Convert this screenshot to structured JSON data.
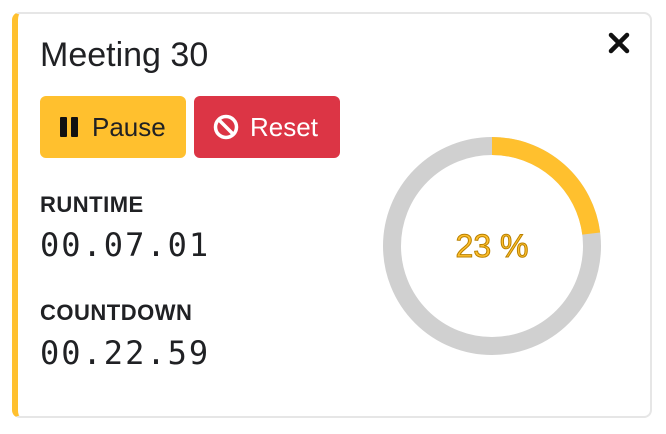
{
  "timer": {
    "title": "Meeting 30",
    "accent_color": "#ffc02e",
    "danger_color": "#dc3545",
    "track_color": "#d0d0d0",
    "close_icon": "close-icon",
    "buttons": {
      "pause": {
        "label": "Pause",
        "icon": "pause-icon"
      },
      "reset": {
        "label": "Reset",
        "icon": "ban-icon"
      }
    },
    "runtime": {
      "label": "RUNTIME",
      "value": "00.07.01"
    },
    "countdown": {
      "label": "COUNTDOWN",
      "value": "00.22.59"
    },
    "progress": {
      "percent": 23,
      "display": "23 %"
    }
  }
}
